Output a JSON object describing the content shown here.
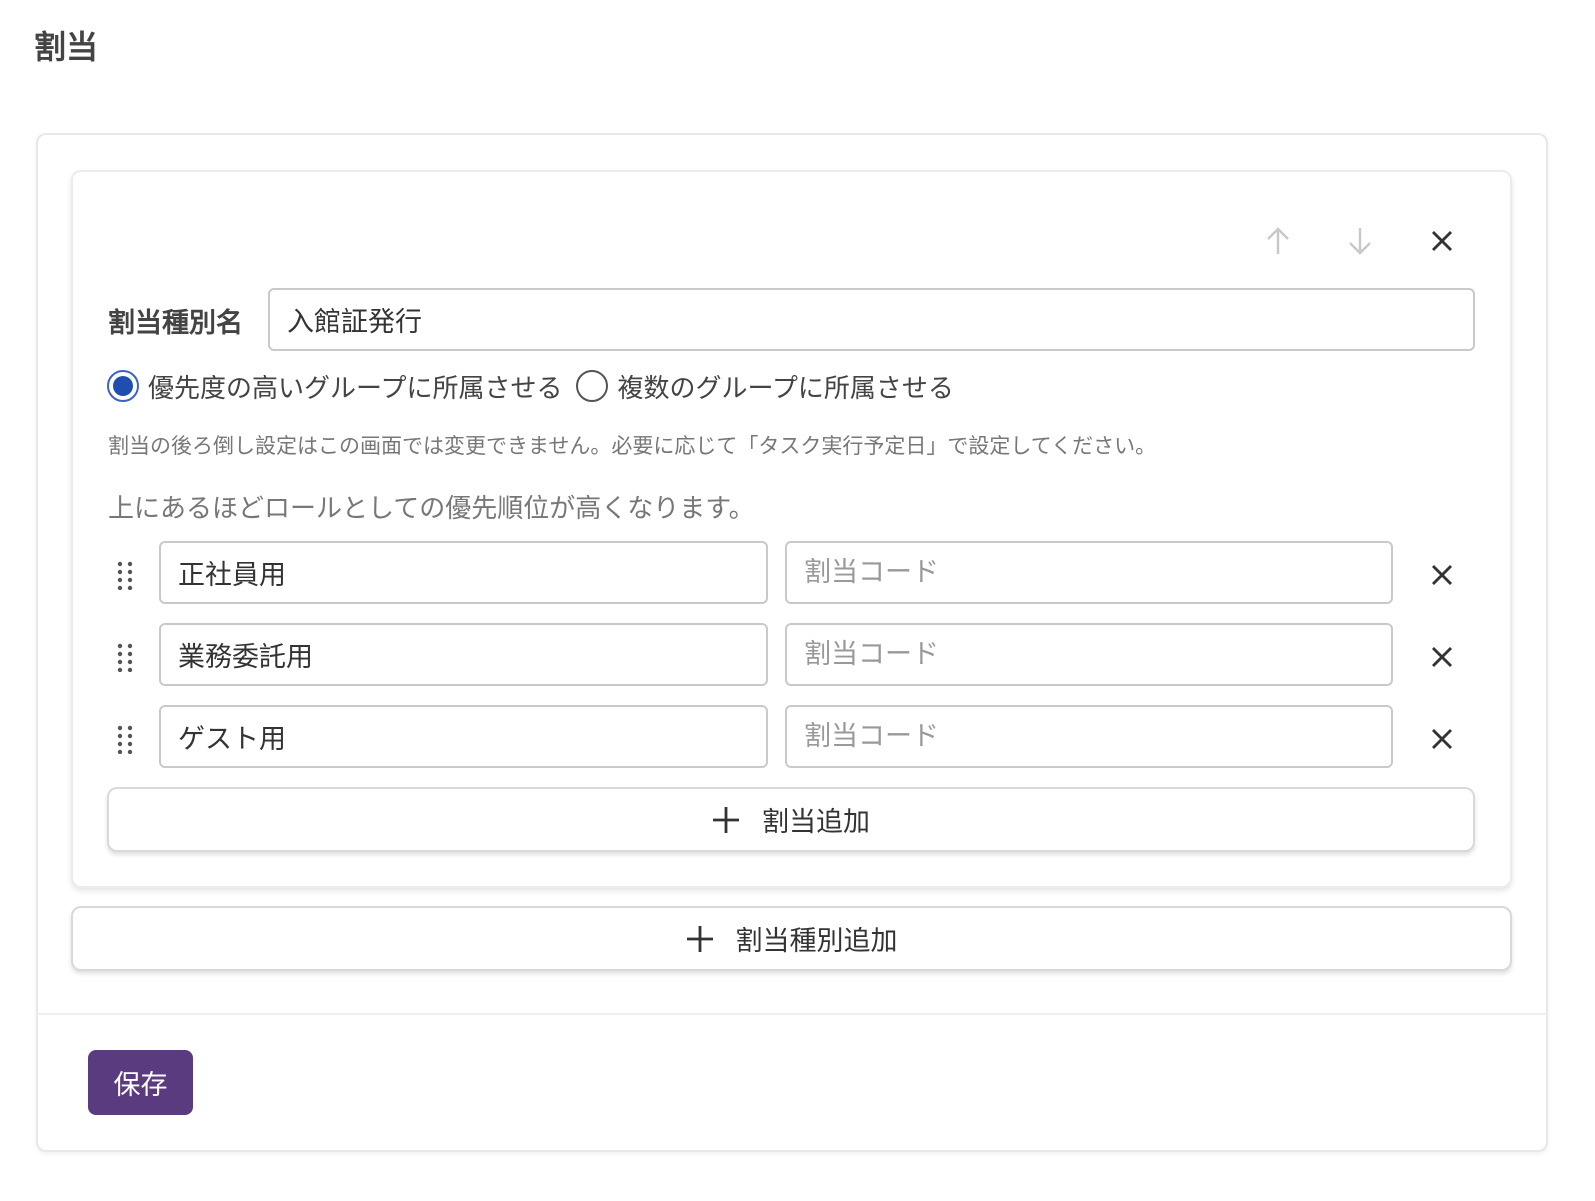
{
  "page": {
    "title": "割当"
  },
  "assignment_type": {
    "name_label": "割当種別名",
    "name_value": "入館証発行",
    "mode_options": [
      {
        "label": "優先度の高いグループに所属させる",
        "selected": true
      },
      {
        "label": "複数のグループに所属させる",
        "selected": false
      }
    ],
    "notice": "割当の後ろ倒し設定はこの画面では変更できません。必要に応じて「タスク実行予定日」で設定してください。",
    "priority_hint": "上にあるほどロールとしての優先順位が高くなります。",
    "assignments": [
      {
        "name": "正社員用",
        "code": "",
        "code_placeholder": "割当コード"
      },
      {
        "name": "業務委託用",
        "code": "",
        "code_placeholder": "割当コード"
      },
      {
        "name": "ゲスト用",
        "code": "",
        "code_placeholder": "割当コード"
      }
    ],
    "add_assignment_label": "割当追加",
    "icons": {
      "up": "arrow-up-icon",
      "down": "arrow-down-icon",
      "remove": "close-icon",
      "drag": "drag-handle-icon",
      "add": "plus-icon"
    },
    "disabled_icon_color": "#c8c8c8"
  },
  "add_type_label": "割当種別追加",
  "save_label": "保存",
  "colors": {
    "primary": "#5b3b80",
    "radio_selected": "#1f4fae"
  }
}
